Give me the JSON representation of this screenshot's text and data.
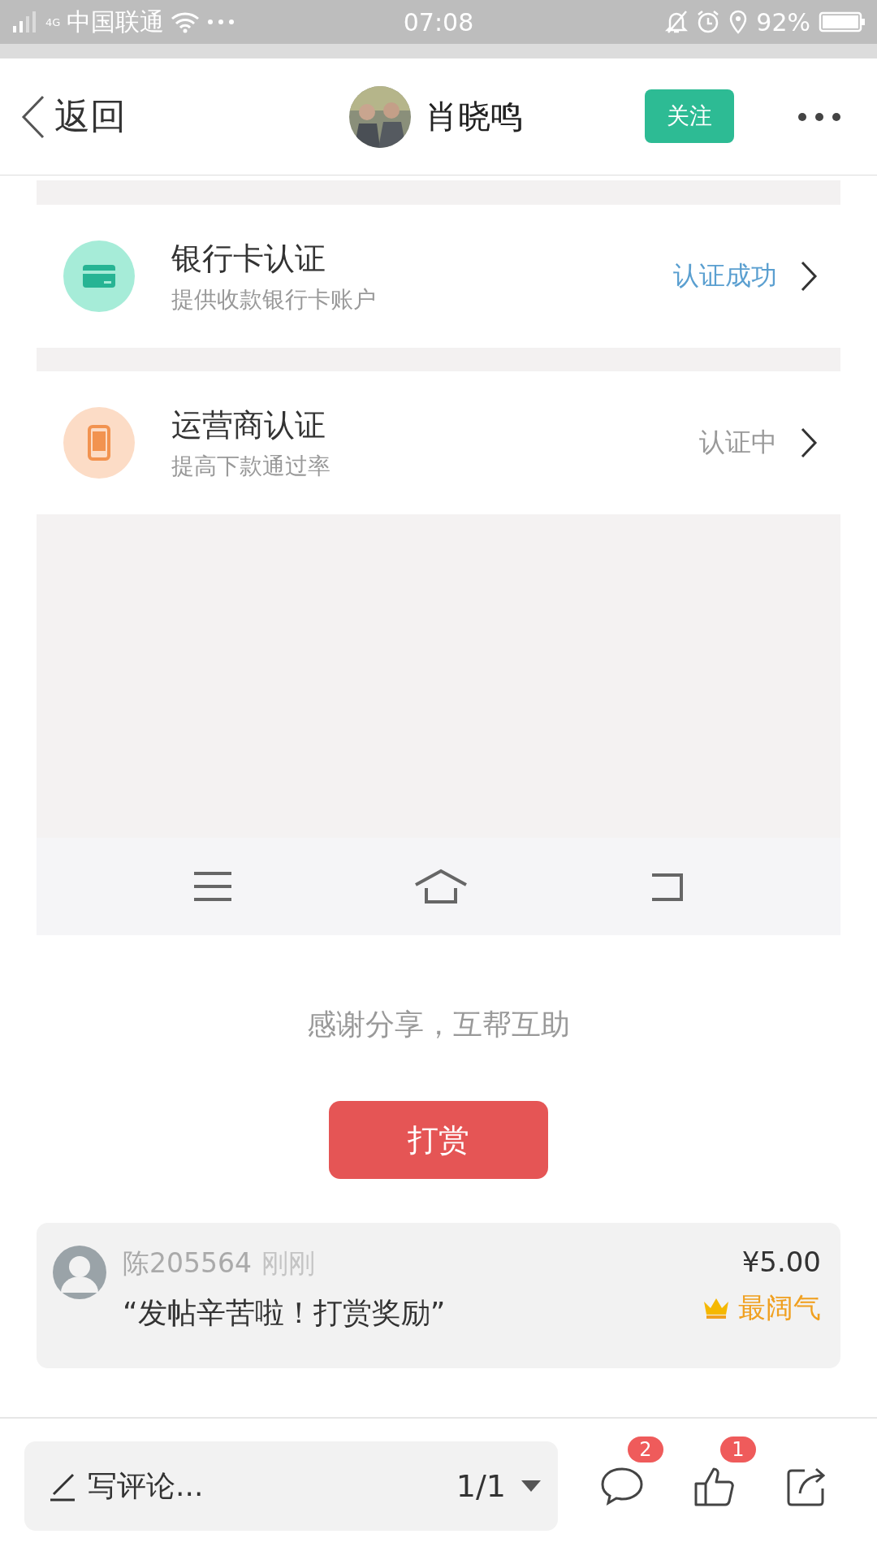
{
  "status_bar": {
    "network": "4G",
    "carrier": "中国联通",
    "time": "07:08",
    "battery_text": "92%"
  },
  "header": {
    "back_label": "返回",
    "user_name": "肖晓鸣",
    "follow_label": "关注"
  },
  "embedded_screenshot": {
    "items": [
      {
        "kind": "card",
        "title": "银行卡认证",
        "subtitle": "提供收款银行卡账户",
        "status": "认证成功",
        "color": "#5a9fd0"
      },
      {
        "kind": "phone",
        "title": "运营商认证",
        "subtitle": "提高下款通过率",
        "status": "认证中",
        "color": "#999999"
      }
    ]
  },
  "thanks_text": "感谢分享，互帮互助",
  "reward_button": "打赏",
  "reward_record": {
    "user": "陈205564",
    "time": "刚刚",
    "message": "“发帖辛苦啦！打赏奖励”",
    "amount": "¥5.00",
    "tag": "最阔气"
  },
  "bottom_bar": {
    "comment_placeholder": "写评论...",
    "page": "1/1",
    "actions": [
      {
        "kind": "comment",
        "badge": "2"
      },
      {
        "kind": "like",
        "badge": "1"
      },
      {
        "kind": "share"
      }
    ]
  }
}
